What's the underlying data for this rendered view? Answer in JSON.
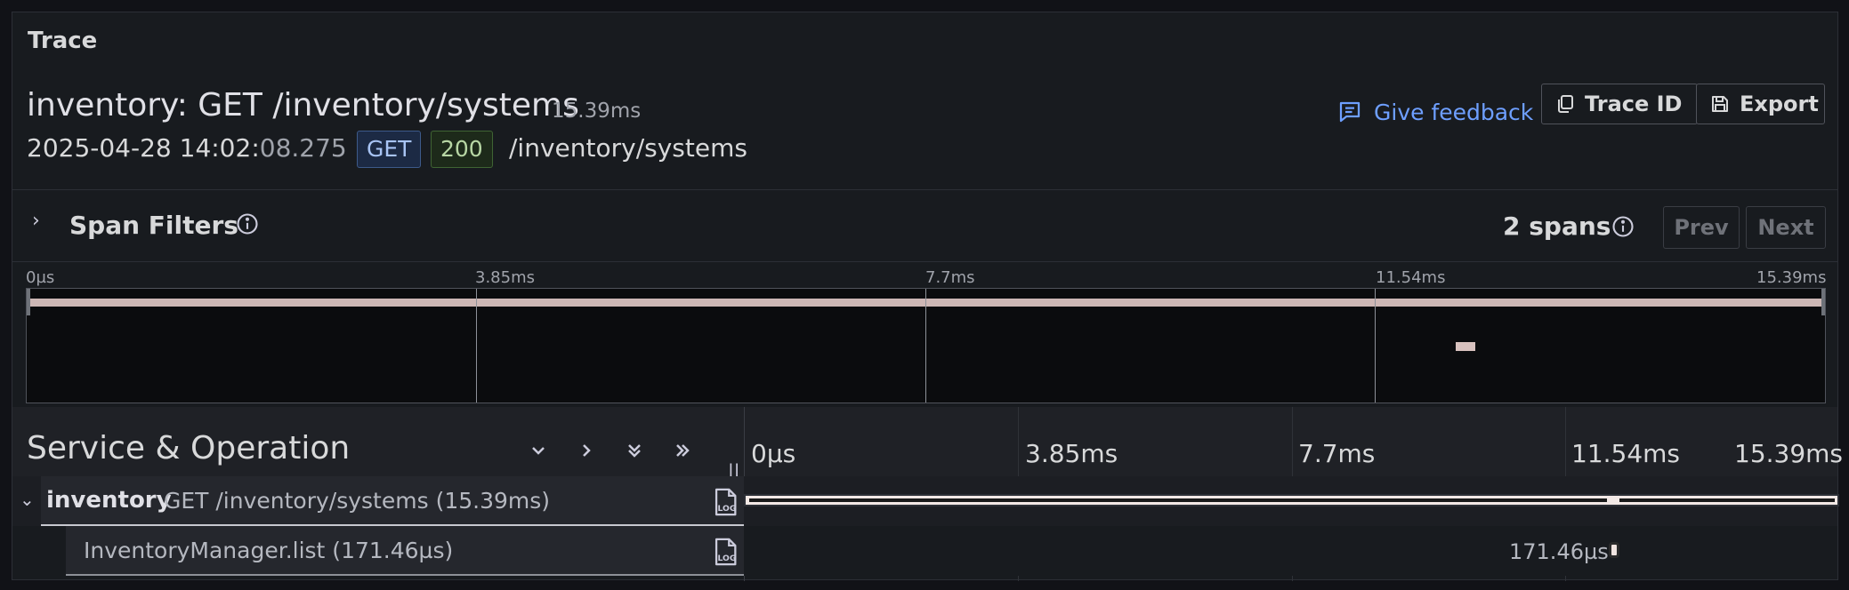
{
  "panel": {
    "title": "Trace"
  },
  "trace": {
    "title": "inventory: GET /inventory/systems",
    "duration": "15.39ms",
    "date_main": "2025-04-28 14:02:",
    "date_ms": "08.275",
    "method": "GET",
    "status": "200",
    "url": "/inventory/systems"
  },
  "actions": {
    "feedback": "Give feedback",
    "trace_id": "Trace ID",
    "export": "Export"
  },
  "filters": {
    "label": "Span Filters",
    "span_count": "2 spans",
    "prev": "Prev",
    "next": "Next"
  },
  "minimap": {
    "ticks": [
      "0µs",
      "3.85ms",
      "7.7ms",
      "11.54ms",
      "15.39ms"
    ]
  },
  "timeline": {
    "header_title": "Service & Operation",
    "ticks": [
      "0µs",
      "3.85ms",
      "7.7ms",
      "11.54ms",
      "15.39ms"
    ]
  },
  "spans": [
    {
      "service": "inventory",
      "operation": "GET /inventory/systems (15.39ms)"
    },
    {
      "operation": "InventoryManager.list (171.46µs)",
      "duration_label": "171.46µs"
    }
  ],
  "icons": {
    "feedback": "comment-icon",
    "trace_id": "copy-icon",
    "export": "save-icon",
    "info": "info-icon",
    "log": "log-icon"
  },
  "colors": {
    "accent_link": "#6e9fff",
    "span_bar": "#f3e9e6",
    "panel_bg": "#181b1f"
  }
}
